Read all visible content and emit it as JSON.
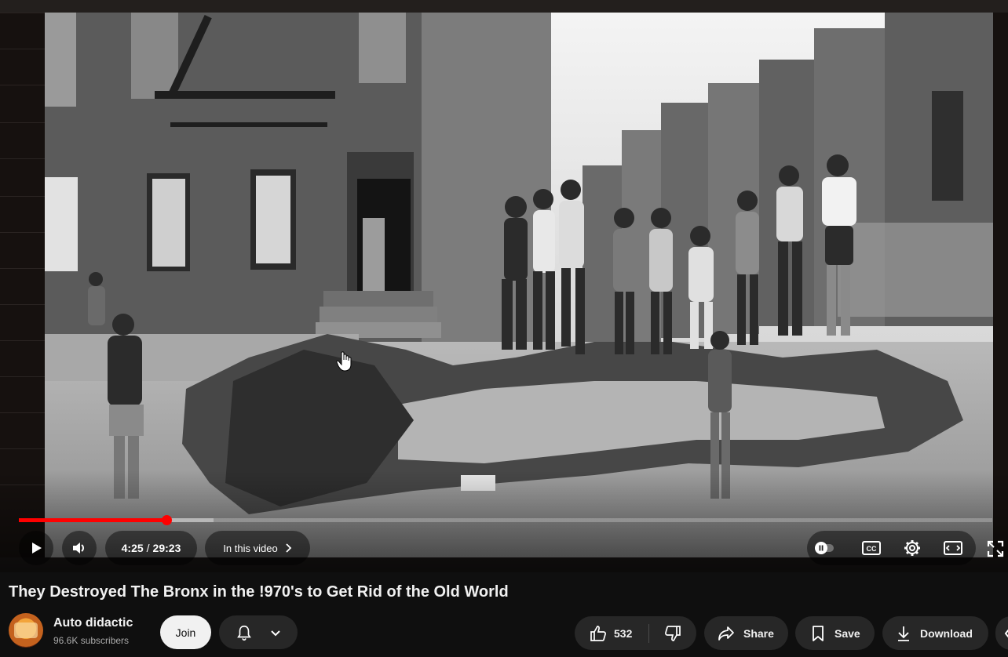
{
  "player": {
    "current_time": "4:25",
    "duration": "29:23",
    "time_separator": "/",
    "progress_fraction": 0.152,
    "buffered_fraction": 0.2,
    "chapters_label": "In this video"
  },
  "video": {
    "title": "They Destroyed The Bronx in the !970's to Get Rid of the Old World"
  },
  "channel": {
    "name": "Auto didactic",
    "subscribers": "96.6K subscribers"
  },
  "actions": {
    "join_label": "Join",
    "like_count": "532",
    "share_label": "Share",
    "save_label": "Save",
    "download_label": "Download"
  },
  "colors": {
    "progress_played": "#ff0000",
    "background": "#0f0f0f",
    "pill": "#272727"
  },
  "icons": [
    "play-icon",
    "volume-icon",
    "chevron-right-icon",
    "autoplay-toggle-icon",
    "captions-icon",
    "settings-gear-icon",
    "theater-mode-icon",
    "fullscreen-icon",
    "bell-icon",
    "chevron-down-icon",
    "thumbs-up-icon",
    "thumbs-down-icon",
    "share-arrow-icon",
    "bookmark-icon",
    "download-icon"
  ]
}
